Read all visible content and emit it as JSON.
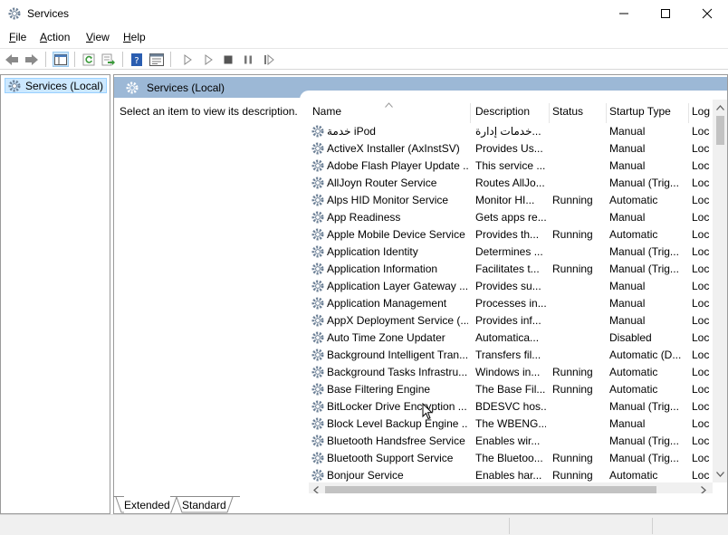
{
  "window": {
    "title": "Services"
  },
  "menu": [
    {
      "key": "F",
      "rest": "ile"
    },
    {
      "key": "A",
      "rest": "ction"
    },
    {
      "key": "V",
      "rest": "iew"
    },
    {
      "key": "H",
      "rest": "elp"
    }
  ],
  "tree": {
    "root_label": "Services (Local)"
  },
  "panel": {
    "header": "Services (Local)",
    "description_prompt": "Select an item to view its description."
  },
  "columns": [
    "Name",
    "Description",
    "Status",
    "Startup Type",
    "Log"
  ],
  "rows": [
    {
      "name": "خدمة iPod",
      "description": "خدمات إدارة...",
      "status": "",
      "startup": "Manual",
      "log": "Loc"
    },
    {
      "name": "ActiveX Installer (AxInstSV)",
      "description": "Provides Us...",
      "status": "",
      "startup": "Manual",
      "log": "Loc"
    },
    {
      "name": "Adobe Flash Player Update ...",
      "description": "This service ...",
      "status": "",
      "startup": "Manual",
      "log": "Loc"
    },
    {
      "name": "AllJoyn Router Service",
      "description": "Routes AllJo...",
      "status": "",
      "startup": "Manual (Trig...",
      "log": "Loc"
    },
    {
      "name": "Alps HID Monitor Service",
      "description": "Monitor HI...",
      "status": "Running",
      "startup": "Automatic",
      "log": "Loc"
    },
    {
      "name": "App Readiness",
      "description": "Gets apps re...",
      "status": "",
      "startup": "Manual",
      "log": "Loc"
    },
    {
      "name": "Apple Mobile Device Service",
      "description": "Provides th...",
      "status": "Running",
      "startup": "Automatic",
      "log": "Loc"
    },
    {
      "name": "Application Identity",
      "description": "Determines ...",
      "status": "",
      "startup": "Manual (Trig...",
      "log": "Loc"
    },
    {
      "name": "Application Information",
      "description": "Facilitates t...",
      "status": "Running",
      "startup": "Manual (Trig...",
      "log": "Loc"
    },
    {
      "name": "Application Layer Gateway ...",
      "description": "Provides su...",
      "status": "",
      "startup": "Manual",
      "log": "Loc"
    },
    {
      "name": "Application Management",
      "description": "Processes in...",
      "status": "",
      "startup": "Manual",
      "log": "Loc"
    },
    {
      "name": "AppX Deployment Service (...",
      "description": "Provides inf...",
      "status": "",
      "startup": "Manual",
      "log": "Loc"
    },
    {
      "name": "Auto Time Zone Updater",
      "description": "Automatica...",
      "status": "",
      "startup": "Disabled",
      "log": "Loc"
    },
    {
      "name": "Background Intelligent Tran...",
      "description": "Transfers fil...",
      "status": "",
      "startup": "Automatic (D...",
      "log": "Loc"
    },
    {
      "name": "Background Tasks Infrastru...",
      "description": "Windows in...",
      "status": "Running",
      "startup": "Automatic",
      "log": "Loc"
    },
    {
      "name": "Base Filtering Engine",
      "description": "The Base Fil...",
      "status": "Running",
      "startup": "Automatic",
      "log": "Loc"
    },
    {
      "name": "BitLocker Drive Encryption ...",
      "description": "BDESVC hos...",
      "status": "",
      "startup": "Manual (Trig...",
      "log": "Loc"
    },
    {
      "name": "Block Level Backup Engine ...",
      "description": "The WBENG...",
      "status": "",
      "startup": "Manual",
      "log": "Loc"
    },
    {
      "name": "Bluetooth Handsfree Service",
      "description": "Enables wir...",
      "status": "",
      "startup": "Manual (Trig...",
      "log": "Loc"
    },
    {
      "name": "Bluetooth Support Service",
      "description": "The Bluetoo...",
      "status": "Running",
      "startup": "Manual (Trig...",
      "log": "Loc"
    },
    {
      "name": "Bonjour Service",
      "description": "Enables har...",
      "status": "Running",
      "startup": "Automatic",
      "log": "Loc"
    }
  ],
  "tabs": [
    "Extended",
    "Standard"
  ],
  "colors": {
    "selection": "#cce8ff",
    "panel_header": "#9cb8d6",
    "accent_blue": "#2a6fc9"
  }
}
